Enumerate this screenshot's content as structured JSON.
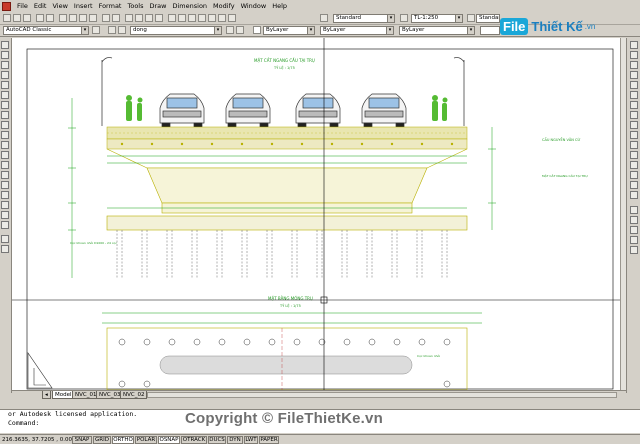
{
  "menu": [
    "File",
    "Edit",
    "View",
    "Insert",
    "Format",
    "Tools",
    "Draw",
    "Dimension",
    "Modify",
    "Window",
    "Help"
  ],
  "toolbar": {
    "text_style": "Standard",
    "dim_style": "TL-1:250",
    "table_style": "Standard",
    "workspace": "AutoCAD Classic",
    "layer": "dong",
    "color": "ByLayer",
    "linetype": "ByLayer",
    "lineweight": "ByLayer"
  },
  "logo": {
    "part1": "File",
    "part2": "Thiết Kế",
    "part3": ".vn"
  },
  "drawing": {
    "top_title": "MẶT CẮT NGANG CẦU TẠI TRỤ",
    "top_scale": "TỶ LỆ : 1/75",
    "bottom_title": "MẶT BẰNG MÓNG TRỤ",
    "bottom_scale": "TỶ LỆ : 1/75",
    "note1": "CẦU NGUYỄN VĂN CỪ",
    "note2": "MẶT CẮT NGANG CẦU TẠI TRỤ",
    "pile_label": "Cọc khoan nhồi D1000 - 24 cọc",
    "pile_label2": "Cọc khoan nhồi"
  },
  "tabs": [
    "Model",
    "NVC_01",
    "NVC_03",
    "NVC_02"
  ],
  "command": {
    "line1": "or Autodesk licensed application.",
    "line2": "Command:"
  },
  "copyright": "Copyright © FileThietKe.vn",
  "status": {
    "coords": "216.3635, 37.7205 , 0.0000",
    "buttons": [
      "SNAP",
      "GRID",
      "ORTHO",
      "POLAR",
      "OSNAP",
      "OTRACK",
      "DUCS",
      "DYN",
      "LWT",
      "PAPER"
    ]
  },
  "colors": {
    "line_yellow": "#d6cc00",
    "line_green": "#12a012",
    "crosshair": "#000000",
    "text_green": "#229922"
  }
}
